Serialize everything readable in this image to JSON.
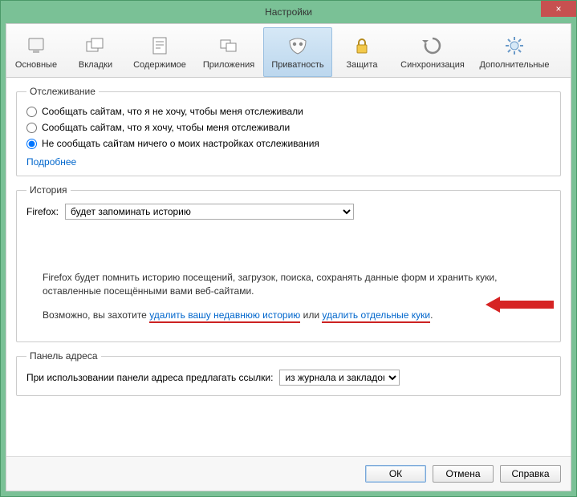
{
  "window": {
    "title": "Настройки",
    "close_label": "×"
  },
  "toolbar": {
    "items": [
      {
        "label": "Основные"
      },
      {
        "label": "Вкладки"
      },
      {
        "label": "Содержимое"
      },
      {
        "label": "Приложения"
      },
      {
        "label": "Приватность"
      },
      {
        "label": "Защита"
      },
      {
        "label": "Синхронизация"
      },
      {
        "label": "Дополнительные"
      }
    ]
  },
  "tracking": {
    "legend": "Отслеживание",
    "option1": "Сообщать сайтам, что я не хочу, чтобы меня отслеживали",
    "option2": "Сообщать сайтам, что я хочу, чтобы меня отслеживали",
    "option3": "Не сообщать сайтам ничего о моих настройках отслеживания",
    "selected": "option3",
    "more_info": "Подробнее"
  },
  "history": {
    "legend": "История",
    "brand_label": "Firefox:",
    "mode_value": "будет запоминать историю",
    "desc": "Firefox будет помнить историю посещений, загрузок, поиска, сохранять данные форм и хранить куки, оставленные посещёнными вами веб-сайтами.",
    "maybe_prefix": "Возможно, вы захотите ",
    "link_clear_history": "удалить вашу недавнюю историю",
    "or_word": " или ",
    "link_clear_cookies": "удалить отдельные куки",
    "period": "."
  },
  "addressbar": {
    "legend": "Панель адреса",
    "label": "При использовании панели адреса предлагать ссылки:",
    "value": "из журнала и закладок"
  },
  "buttons": {
    "ok": "ОК",
    "cancel": "Отмена",
    "help": "Справка"
  }
}
